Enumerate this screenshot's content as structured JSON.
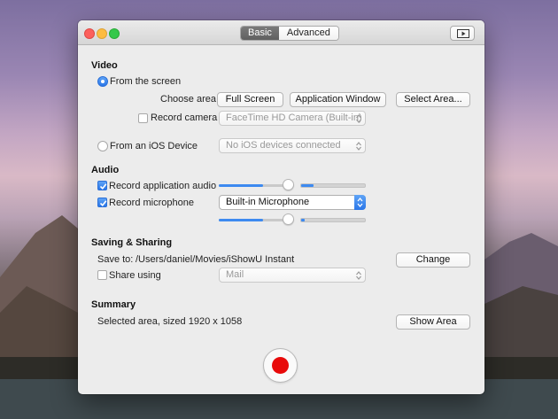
{
  "titlebar": {
    "tabs": [
      {
        "label": "Basic",
        "active": true
      },
      {
        "label": "Advanced",
        "active": false
      }
    ],
    "preview_icon": "play-screen-icon"
  },
  "video": {
    "title": "Video",
    "from_screen_label": "From the screen",
    "from_screen_selected": true,
    "choose_area_label": "Choose area",
    "area_buttons": [
      "Full Screen",
      "Application Window",
      "Select Area..."
    ],
    "record_camera_label": "Record camera",
    "record_camera_checked": false,
    "camera_value": "FaceTime HD Camera (Built-in)",
    "from_ios_label": "From an iOS Device",
    "from_ios_selected": false,
    "ios_value": "No iOS devices connected"
  },
  "audio": {
    "title": "Audio",
    "app_audio_label": "Record application audio",
    "app_audio_checked": true,
    "app_audio_volume": 0.59,
    "app_audio_level": 0.2,
    "mic_label": "Record microphone",
    "mic_checked": true,
    "mic_value": "Built-in Microphone",
    "mic_volume": 0.59,
    "mic_level": 0.05
  },
  "saving": {
    "title": "Saving & Sharing",
    "save_to_label": "Save to:",
    "save_path": "/Users/daniel/Movies/iShowU Instant",
    "change_label": "Change",
    "share_label": "Share using",
    "share_checked": false,
    "share_value": "Mail"
  },
  "summary": {
    "title": "Summary",
    "text": "Selected area, sized 1920 x 1058",
    "show_area_label": "Show Area"
  },
  "colors": {
    "accent": "#3d8af0",
    "record": "#e80a0a"
  }
}
